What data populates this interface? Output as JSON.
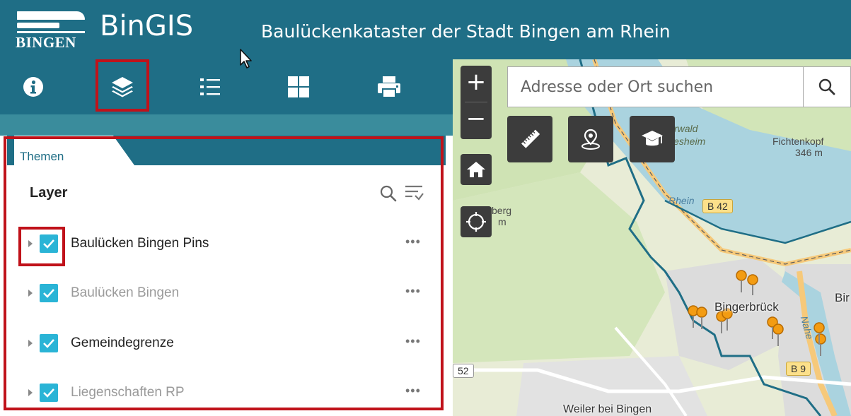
{
  "header": {
    "logo_text": "BINGEN",
    "app_name": "BinGIS",
    "subtitle": "Baulückenkataster der Stadt Bingen am Rhein"
  },
  "toolbar": {
    "tools": [
      {
        "name": "info-icon",
        "active": false
      },
      {
        "name": "layers-icon",
        "active": true
      },
      {
        "name": "legend-list-icon",
        "active": false
      },
      {
        "name": "basemap-grid-icon",
        "active": false
      },
      {
        "name": "print-icon",
        "active": false
      }
    ]
  },
  "panel": {
    "tab_label": "Themen",
    "heading": "Layer",
    "layers": [
      {
        "label": "Baulücken Bingen Pins",
        "checked": true,
        "dimmed": false,
        "more": "•••"
      },
      {
        "label": "Baulücken Bingen",
        "checked": true,
        "dimmed": true,
        "more": "•••"
      },
      {
        "label": "Gemeindegrenze",
        "checked": true,
        "dimmed": false,
        "more": "•••"
      },
      {
        "label": "Liegenschaften RP",
        "checked": true,
        "dimmed": true,
        "more": "•••"
      }
    ]
  },
  "map": {
    "zoom_in": "+",
    "zoom_out": "−",
    "search_placeholder": "Adresse oder Ort suchen",
    "labels": {
      "forest_1": "rwald",
      "forest_2": "lesheim",
      "peak_name": "Fichtenkopf",
      "peak_height": "346 m",
      "river": "Rhein",
      "berg": "berg",
      "berg_m": "m",
      "road_b42": "B 42",
      "road_b9": "B 9",
      "road_52": "52",
      "town_1": "Bingerbrück",
      "town_2": "Bir",
      "town_3": "Weiler bei Bingen",
      "river_nahe": "Nahe"
    }
  },
  "colors": {
    "header_bg": "#1f6e86",
    "band_bg": "#3a8c9c",
    "checkbox": "#2ab4d6",
    "highlight": "#c0121a"
  }
}
